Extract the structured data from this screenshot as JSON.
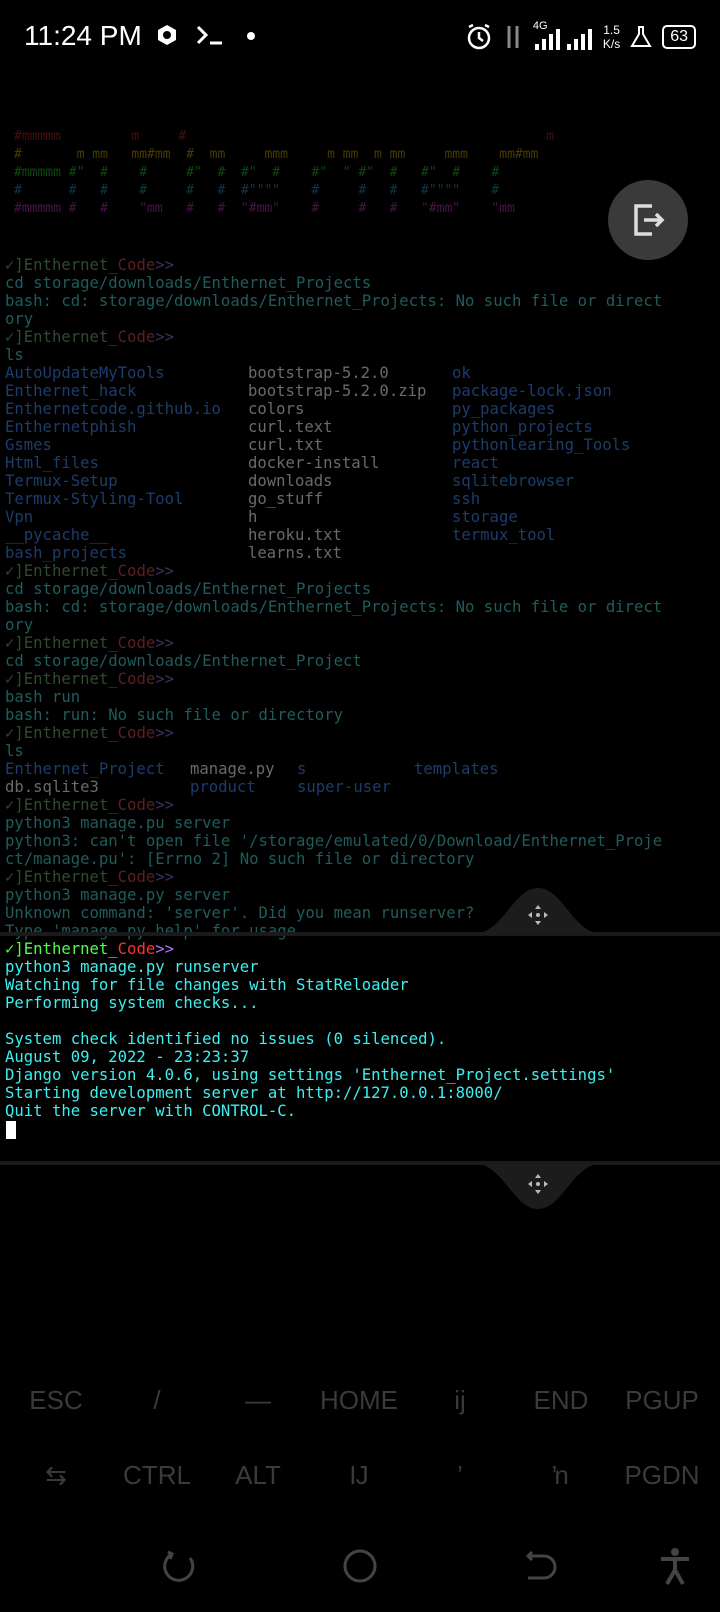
{
  "status_bar": {
    "time": "11:24 PM",
    "network": "4G",
    "speed_value": "1.5",
    "speed_unit": "K/s",
    "battery": "63"
  },
  "ascii_banner": [
    "#mmmmm         m     #                                              m",
    "#       m mm   mm#mm  #  mm     mmm     m mm  m mm     mmm    mm#mm",
    "#mmmmm #\"  #    #     #\"  #  #\"  #    #\"  \" #\"  #   #\"  #    #",
    "#      #   #    #     #   #  #\"\"\"\"    #     #   #   #\"\"\"\"    #",
    "#mmmmm #   #    \"mm   #   #  \"#mm\"    #     #   #   \"#mm\"    \"mm"
  ],
  "terminal_history": {
    "prompt_symbol": "✓]",
    "prompt_name_a": "Enthernet_",
    "prompt_name_b": "Code",
    "prompt_chevrons": ">>",
    "block1": "cd storage/downloads/Enthernet_Projects\nbash: cd: storage/downloads/Enthernet_Projects: No such file or direct\nory",
    "ls_cmd": "ls",
    "ls_col1": "AutoUpdateMyTools\nEnthernet_hack\nEnthernetcode.github.io\nEnthernetphish\nGsmes\nHtml_files\nTermux-Setup\nTermux-Styling-Tool\nVpn\n__pycache__\nbash_projects",
    "ls_col2": "bootstrap-5.2.0\nbootstrap-5.2.0.zip\ncolors\ncurl.text\ncurl.txt\ndocker-install\ndownloads\ngo_stuff\nh\nheroku.txt\nlearns.txt",
    "ls_col3": "ok\npackage-lock.json\npy_packages\npython_projects\npythonlearing_Tools\nreact\nsqlitebrowser\nssh\nstorage\ntermux_tool",
    "block3": "cd storage/downloads/Enthernet_Projects\nbash: cd: storage/downloads/Enthernet_Projects: No such file or direct\nory",
    "block4": "cd storage/downloads/Enthernet_Project",
    "block5": "bash run\nbash: run: No such file or directory",
    "ls2_row1a": "Enthernet_Project",
    "ls2_row1b": "manage.py",
    "ls2_row1c": "s",
    "ls2_row1d": "templates",
    "ls2_row2a": "db.sqlite3",
    "ls2_row2b": "product",
    "ls2_row2c": "super-user",
    "block7": "python3 manage.pu server\npython3: can't open file '/storage/emulated/0/Download/Enthernet_Proje\nct/manage.pu': [Errno 2] No such file or directory",
    "block8": "python3 manage.py server\nUnknown command: 'server'. Did you mean runserver?\nType 'manage.py help' for usage."
  },
  "terminal_active": {
    "command": "python3 manage.py runserver",
    "output": "Watching for file changes with StatReloader\nPerforming system checks...\n\nSystem check identified no issues (0 silenced).\nAugust 09, 2022 - 23:23:37\nDjango version 4.0.6, using settings 'Enthernet_Project.settings'\nStarting development server at http://127.0.0.1:8000/\nQuit the server with CONTROL-C."
  },
  "extra_keys": {
    "row1": [
      "ESC",
      "/",
      "—",
      "HOME",
      "ij",
      "END",
      "PGUP"
    ],
    "row2": [
      "⇆",
      "CTRL",
      "ALT",
      "Ĳ",
      "’",
      "ŉ",
      "PGDN"
    ]
  },
  "icons": {
    "exit": "exit-icon",
    "move": "move-icon",
    "alarm": "alarm-icon",
    "signal": "signal-icon",
    "flask": "flask-icon",
    "recent": "recent-apps-icon",
    "home": "home-icon",
    "back": "back-icon",
    "accessibility": "accessibility-icon"
  }
}
